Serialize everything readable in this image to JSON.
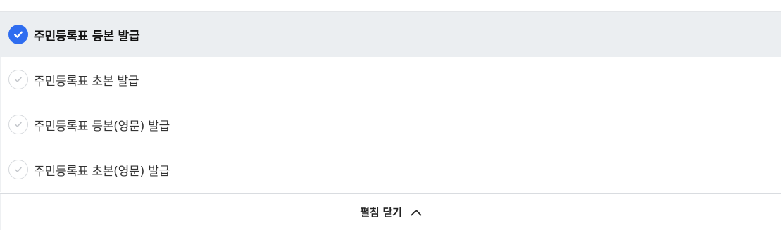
{
  "options": [
    {
      "label": "주민등록표 등본 발급",
      "selected": true,
      "icon": "check-circle-filled-icon"
    },
    {
      "label": "주민등록표 초본 발급",
      "selected": false,
      "icon": "check-circle-outline-icon"
    },
    {
      "label": "주민등록표 등본(영문) 발급",
      "selected": false,
      "icon": "check-circle-outline-icon"
    },
    {
      "label": "주민등록표 초본(영문) 발급",
      "selected": false,
      "icon": "check-circle-outline-icon"
    }
  ],
  "footer": {
    "collapse_label": "펼침 닫기",
    "icon": "chevron-up-icon"
  },
  "colors": {
    "accent": "#2f6df0",
    "selected_bg": "#ebeef1",
    "unselected_check_border": "#d6d9dd",
    "unselected_check_mark": "#c4c7cc"
  }
}
